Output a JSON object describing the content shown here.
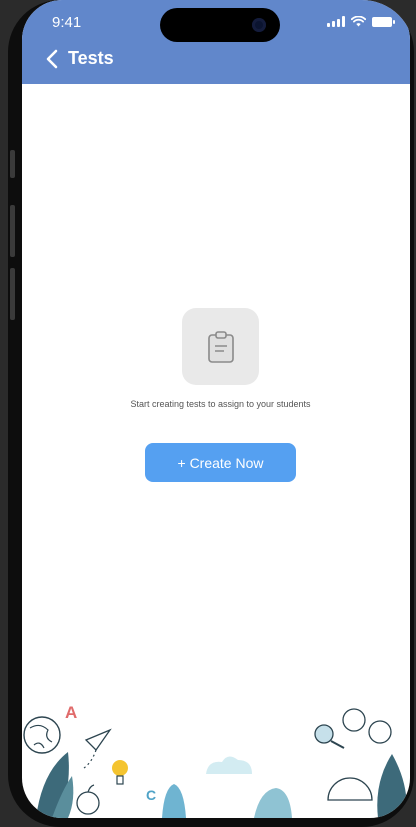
{
  "status_bar": {
    "time": "9:41"
  },
  "nav": {
    "title": "Tests"
  },
  "empty_state": {
    "icon": "clipboard-icon",
    "message": "Start creating tests to assign to your students",
    "button_label": "+ Create Now"
  },
  "doodle_letters": {
    "a": "A",
    "c": "C"
  },
  "colors": {
    "header": "#6187cb",
    "button": "#55a0f1",
    "icon_box": "#e9e9e9"
  }
}
